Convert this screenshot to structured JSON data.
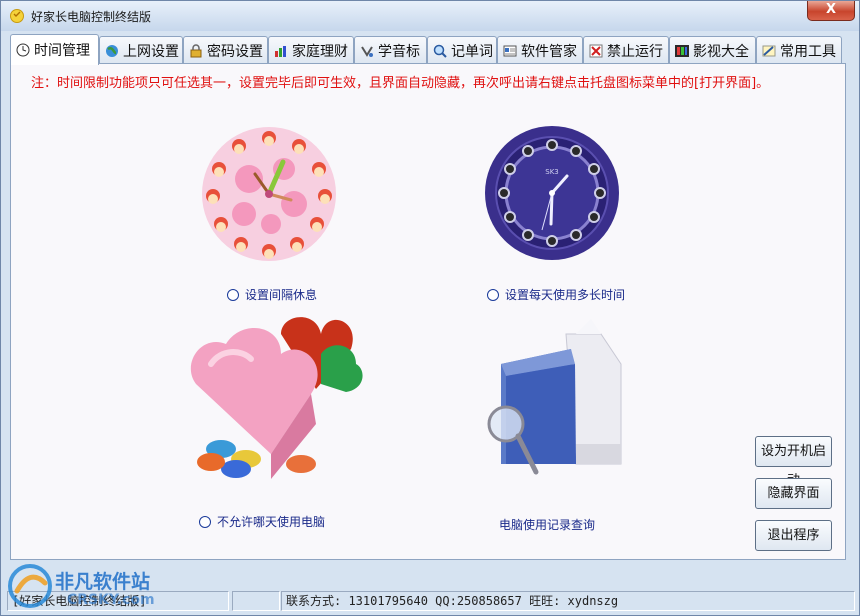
{
  "window": {
    "title": "好家长电脑控制终结版",
    "close_label": "X"
  },
  "tabs": [
    {
      "label": "时间管理",
      "icon": "clock-icon",
      "active": true
    },
    {
      "label": "上网设置",
      "icon": "globe-icon"
    },
    {
      "label": "密码设置",
      "icon": "lock-icon"
    },
    {
      "label": "家庭理财",
      "icon": "chart-icon"
    },
    {
      "label": "学音标",
      "icon": "phonetic-icon"
    },
    {
      "label": "记单词",
      "icon": "magnifier-icon"
    },
    {
      "label": "软件管家",
      "icon": "software-icon"
    },
    {
      "label": "禁止运行",
      "icon": "forbid-icon"
    },
    {
      "label": "影视大全",
      "icon": "film-icon"
    },
    {
      "label": "常用工具",
      "icon": "tools-icon"
    }
  ],
  "panel": {
    "notice": "注：时间限制功能项只可任选其一，设置完毕后即可生效，且界面自动隐藏，再次呼出请右键点击托盘图标菜单中的[打开界面]。",
    "options": {
      "interval_rest": "设置间隔休息",
      "daily_limit": "设置每天使用多长时间",
      "forbid_days": "不允许哪天使用电脑",
      "usage_log": "电脑使用记录查询"
    },
    "clock_brand": "SK3"
  },
  "buttons": {
    "autostart": "设为开机启动",
    "hide": "隐藏界面",
    "exit": "退出程序"
  },
  "statusbar": {
    "app_name": "[好家长电脑控制终结版]",
    "contact": "联系方式: 13101795640   QQ:250858657   旺旺: xydnszg"
  },
  "watermark": {
    "site": "非凡软件站",
    "domain": "CRSKY.com"
  },
  "colors": {
    "notice": "#e01010",
    "option_text": "#1a2a8a"
  }
}
